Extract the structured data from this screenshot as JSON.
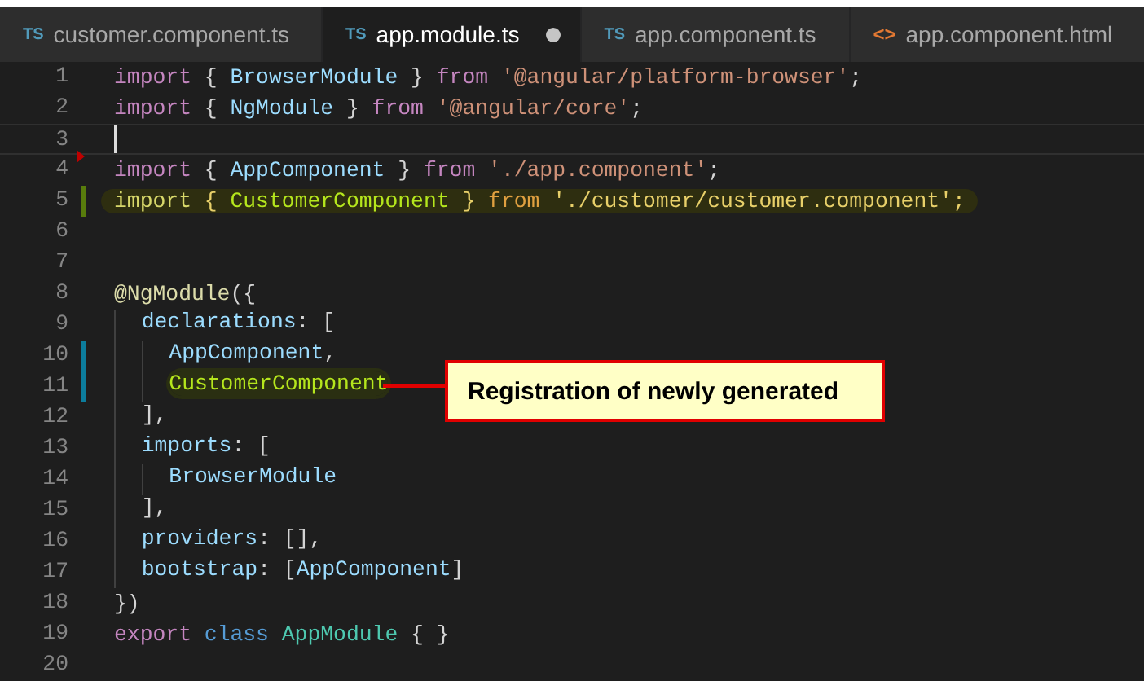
{
  "tabs": [
    {
      "icon": "TS",
      "kind": "ts",
      "label": "customer.component.ts",
      "selected": false,
      "modified": false
    },
    {
      "icon": "TS",
      "kind": "ts",
      "label": "app.module.ts",
      "selected": true,
      "modified": true
    },
    {
      "icon": "TS",
      "kind": "ts",
      "label": "app.component.ts",
      "selected": false,
      "modified": false
    },
    {
      "icon": "<>",
      "kind": "html",
      "label": "app.component.html",
      "selected": false,
      "modified": false
    }
  ],
  "lines": [
    {
      "number": "1",
      "kind": "plain",
      "tokens": [
        {
          "text": "import",
          "kind": "keyword"
        },
        {
          "text": " { ",
          "kind": "punct"
        },
        {
          "text": "BrowserModule",
          "kind": "ident"
        },
        {
          "text": " } ",
          "kind": "punct"
        },
        {
          "text": "from ",
          "kind": "keyword"
        },
        {
          "text": "'@angular/platform-browser'",
          "kind": "string"
        },
        {
          "text": ";",
          "kind": "punct"
        }
      ]
    },
    {
      "number": "2",
      "kind": "plain",
      "tokens": [
        {
          "text": "import",
          "kind": "keyword"
        },
        {
          "text": " { ",
          "kind": "punct"
        },
        {
          "text": "NgModule",
          "kind": "ident"
        },
        {
          "text": " } ",
          "kind": "punct"
        },
        {
          "text": "from ",
          "kind": "keyword"
        },
        {
          "text": "'@angular/core'",
          "kind": "string"
        },
        {
          "text": ";",
          "kind": "punct"
        }
      ]
    },
    {
      "number": "3",
      "kind": "deleted",
      "cursor": true
    },
    {
      "number": "4",
      "kind": "plain",
      "tokens": [
        {
          "text": "import",
          "kind": "keyword"
        },
        {
          "text": " { ",
          "kind": "punct"
        },
        {
          "text": "AppComponent",
          "kind": "ident"
        },
        {
          "text": " } ",
          "kind": "punct"
        },
        {
          "text": "from ",
          "kind": "keyword"
        },
        {
          "text": "'./app.component'",
          "kind": "string"
        },
        {
          "text": ";",
          "kind": "punct"
        }
      ]
    },
    {
      "number": "5",
      "kind": "added",
      "highlighted": true,
      "tokens": [
        {
          "text": "import",
          "kind": "hl-keyword"
        },
        {
          "text": " { ",
          "kind": "hl-punct"
        },
        {
          "text": "CustomerComponent",
          "kind": "match"
        },
        {
          "text": " } ",
          "kind": "hl-punct"
        },
        {
          "text": "from ",
          "kind": "hl-from"
        },
        {
          "text": "'./customer/customer.component'",
          "kind": "hl-punct"
        },
        {
          "text": ";",
          "kind": "hl-punct"
        }
      ]
    },
    {
      "number": "6",
      "kind": "plain"
    },
    {
      "number": "7",
      "kind": "plain"
    },
    {
      "number": "8",
      "kind": "plain",
      "tokens": [
        {
          "text": "@NgModule",
          "kind": "decorator"
        },
        {
          "text": "({",
          "kind": "punct"
        }
      ]
    },
    {
      "number": "9",
      "kind": "plain",
      "tokens": [
        {
          "text": "  declarations",
          "kind": "ident"
        },
        {
          "text": ": [",
          "kind": "punct"
        }
      ]
    },
    {
      "number": "10",
      "kind": "modified",
      "tokens": [
        {
          "text": "    AppComponent",
          "kind": "ident"
        },
        {
          "text": ",",
          "kind": "punct"
        }
      ]
    },
    {
      "number": "11",
      "kind": "modified",
      "tokens": [
        {
          "text": "    CustomerComponent",
          "kind": "match-word"
        }
      ]
    },
    {
      "number": "12",
      "kind": "plain",
      "tokens": [
        {
          "text": "  ],",
          "kind": "punct"
        }
      ]
    },
    {
      "number": "13",
      "kind": "plain",
      "tokens": [
        {
          "text": "  imports",
          "kind": "ident"
        },
        {
          "text": ": [",
          "kind": "punct"
        }
      ]
    },
    {
      "number": "14",
      "kind": "plain",
      "tokens": [
        {
          "text": "    BrowserModule",
          "kind": "ident"
        }
      ]
    },
    {
      "number": "15",
      "kind": "plain",
      "tokens": [
        {
          "text": "  ],",
          "kind": "punct"
        }
      ]
    },
    {
      "number": "16",
      "kind": "plain",
      "tokens": [
        {
          "text": "  providers",
          "kind": "ident"
        },
        {
          "text": ": [],",
          "kind": "punct"
        }
      ]
    },
    {
      "number": "17",
      "kind": "plain",
      "tokens": [
        {
          "text": "  bootstrap",
          "kind": "ident"
        },
        {
          "text": ": [",
          "kind": "punct"
        },
        {
          "text": "AppComponent",
          "kind": "ident"
        },
        {
          "text": "]",
          "kind": "punct"
        }
      ]
    },
    {
      "number": "18",
      "kind": "plain",
      "tokens": [
        {
          "text": "})",
          "kind": "punct"
        }
      ]
    },
    {
      "number": "19",
      "kind": "plain",
      "tokens": [
        {
          "text": "export ",
          "kind": "keyword"
        },
        {
          "text": "class ",
          "kind": "storage"
        },
        {
          "text": "AppModule",
          "kind": "class"
        },
        {
          "text": " { }",
          "kind": "punct"
        }
      ]
    },
    {
      "number": "20",
      "kind": "plain"
    }
  ],
  "callout": {
    "text": "Registration of newly generated"
  }
}
